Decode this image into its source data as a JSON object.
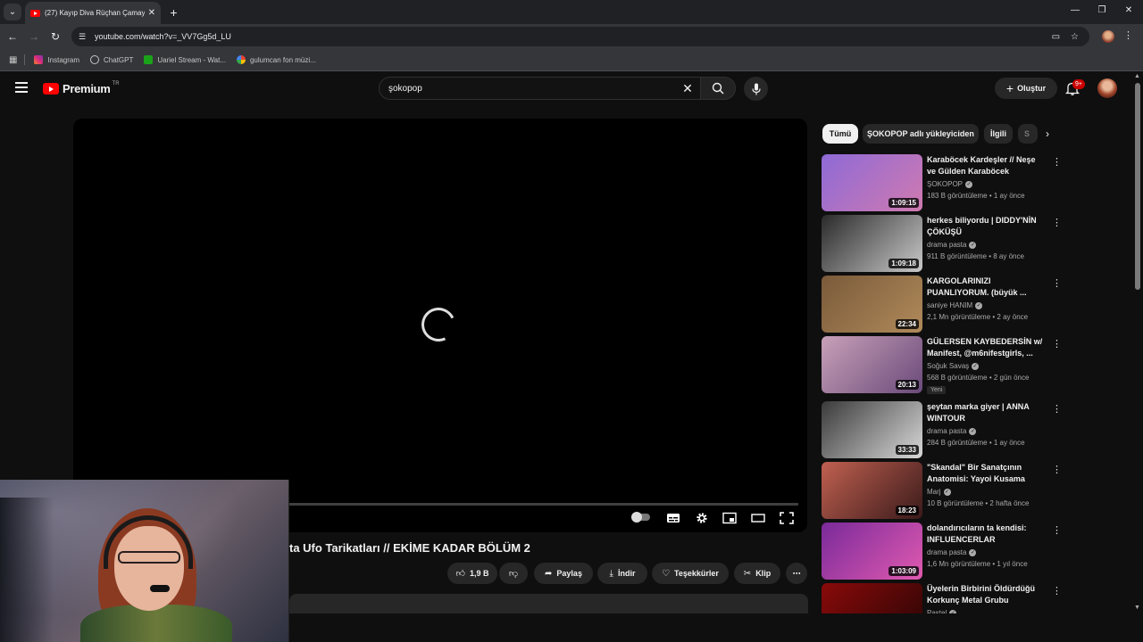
{
  "browser": {
    "tab_title": "(27) Kayıp Diva Rüçhan Çamay",
    "url": "youtube.com/watch?v=_VV7Gg5d_LU",
    "bookmarks": [
      {
        "label": "Instagram",
        "color": "#d62976"
      },
      {
        "label": "ChatGPT",
        "color": "#35363a"
      },
      {
        "label": "Uariel Stream - Wat...",
        "color": "#1aa31a"
      },
      {
        "label": "gulumcan fon müzi...",
        "color": "#4285f4"
      }
    ]
  },
  "youtube": {
    "logo_text": "Premium",
    "region": "TR",
    "search_value": "şokopop",
    "create_label": "Oluştur",
    "notif_count": "9+"
  },
  "video": {
    "title": "...ta Ufo Tarikatları // EKİME KADAR BÖLÜM 2",
    "title_visible": "ta Ufo Tarikatları // EKİME KADAR BÖLÜM 2",
    "actions": {
      "likes": "1,9 B",
      "share": "Paylaş",
      "download": "İndir",
      "thanks": "Teşekkürler",
      "clip": "Klip"
    }
  },
  "chips": [
    "Tümü",
    "ŞOKOPOP adlı yükleyiciden",
    "İlgili",
    "S"
  ],
  "recommendations": [
    {
      "title": "Karaböcek Kardeşler // Neşe ve Gülden Karaböcek Hakkında ...",
      "channel": "ŞOKOPOP",
      "meta": "183 B görüntüleme • 1 ay önce",
      "duration": "1:09:15",
      "badge": "",
      "c1": "#8e6ad6",
      "c2": "#d07ab0"
    },
    {
      "title": "herkes biliyordu | DIDDY'NİN ÇÖKÜŞÜ",
      "channel": "drama pasta",
      "meta": "911 B görüntüleme • 8 ay önce",
      "duration": "1:09:18",
      "badge": "",
      "c1": "#2a2a2a",
      "c2": "#c9c9c9"
    },
    {
      "title": "KARGOLARINIZI PUANLIYORUM. (büyük ...",
      "channel": "saniye HANIM",
      "meta": "2,1 Mn görüntüleme • 2 ay önce",
      "duration": "22:34",
      "badge": "",
      "c1": "#7a5a3a",
      "c2": "#b08a5a"
    },
    {
      "title": "GÜLERSEN KAYBEDERSİN w/ Manifest, @m6nifestgirls, ...",
      "channel": "Soğuk Savaş",
      "meta": "568 B görüntüleme • 2 gün önce",
      "duration": "20:13",
      "badge": "Yeni",
      "c1": "#c8a0b8",
      "c2": "#6a4a7a"
    },
    {
      "title": "şeytan marka giyer | ANNA WINTOUR",
      "channel": "drama pasta",
      "meta": "284 B görüntüleme • 1 ay önce",
      "duration": "33:33",
      "badge": "",
      "c1": "#3a3a3a",
      "c2": "#d9d9d9"
    },
    {
      "title": "\"Skandal\" Bir Sanatçının Anatomisi: Yayoi Kusama",
      "channel": "Marj",
      "meta": "10 B görüntüleme • 2 hafta önce",
      "duration": "18:23",
      "badge": "",
      "c1": "#c06050",
      "c2": "#3a1a1a"
    },
    {
      "title": "dolandırıcıların ta kendisi: INFLUENCERLAR",
      "channel": "drama pasta",
      "meta": "1,6 Mn görüntüleme • 1 yıl önce",
      "duration": "1:03:09",
      "badge": "",
      "c1": "#7a2a9a",
      "c2": "#e05ab0"
    },
    {
      "title": "Üyelerin Birbirini Öldürdüğü Korkunç Metal Grubu",
      "channel": "Pastel",
      "meta": "",
      "duration": "",
      "badge": "",
      "c1": "#8a0a0a",
      "c2": "#2a0505"
    }
  ]
}
